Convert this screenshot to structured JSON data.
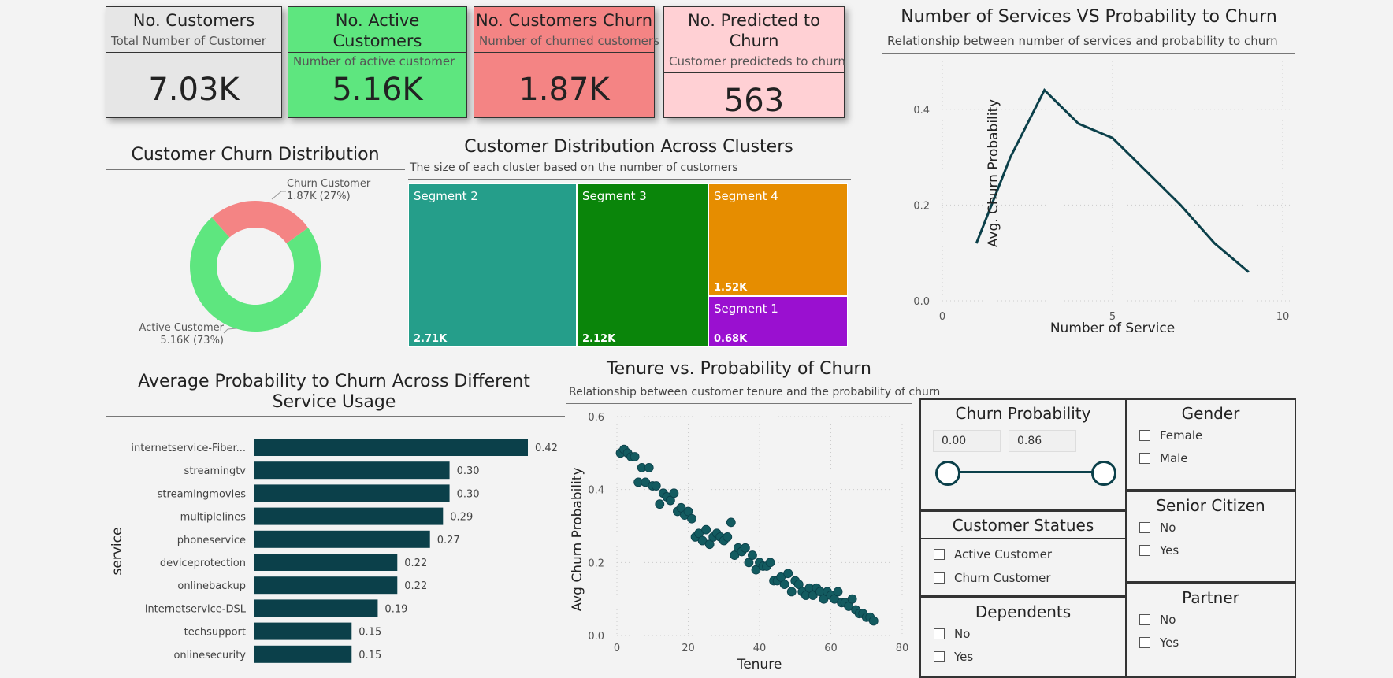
{
  "kpis": {
    "total": {
      "title": "No. Customers",
      "subtitle": "Total Number of Customer",
      "value": "7.03K"
    },
    "active": {
      "title": "No. Active Customers",
      "subtitle": "Number of active customer",
      "value": "5.16K"
    },
    "churn": {
      "title": "No. Customers Churn",
      "subtitle": "Number of churned customers",
      "value": "1.87K"
    },
    "predicted": {
      "title": "No. Predicted to Churn",
      "subtitle": "Customer predicteds to churn",
      "value": "563"
    }
  },
  "colors": {
    "active": "#5ee67f",
    "churn": "#f48484",
    "predicted": "#ffd0d4",
    "total": "#e6e6e6",
    "teal": "#0b404a"
  },
  "chart_data": [
    {
      "type": "pie",
      "title": "Customer Churn Distribution",
      "categories": [
        "Churn Customer",
        "Active Customer"
      ],
      "values": [
        1.87,
        5.16
      ],
      "labels": [
        "Churn Customer",
        "Active Customer"
      ],
      "value_labels": [
        "1.87K (27%)",
        "5.16K (73%)"
      ],
      "colors": [
        "#f48484",
        "#5ee67f"
      ]
    },
    {
      "type": "treemap",
      "title": "Customer Distribution Across Clusters",
      "subtitle": "The size of each cluster based on the number of customers",
      "categories": [
        "Segment 2",
        "Segment 3",
        "Segment 4",
        "Segment 1"
      ],
      "values": [
        2.71,
        2.12,
        1.52,
        0.68
      ],
      "value_labels": [
        "2.71K",
        "2.12K",
        "1.52K",
        "0.68K"
      ],
      "colors": [
        "#259e8a",
        "#0a850a",
        "#e68d00",
        "#9a10d0"
      ]
    },
    {
      "type": "line",
      "title": "Number of Services VS Probability to Churn",
      "subtitle": "Relationship between number of services and probability to churn",
      "xlabel": "Number of Service",
      "ylabel": "Avg. Churn Probability",
      "x": [
        1,
        2,
        3,
        4,
        5,
        6,
        7,
        8,
        9
      ],
      "y": [
        0.12,
        0.3,
        0.44,
        0.37,
        0.34,
        0.27,
        0.2,
        0.12,
        0.06
      ],
      "xlim": [
        0,
        10
      ],
      "ylim": [
        0,
        0.5
      ],
      "xticks": [
        "0",
        "5",
        "10"
      ],
      "yticks": [
        "0.0",
        "0.2",
        "0.4"
      ]
    },
    {
      "type": "bar",
      "title": "Average Probability to Churn Across Different Service Usage",
      "ylabel": "service",
      "categories": [
        "internetservice-Fiber...",
        "streamingtv",
        "streamingmovies",
        "multiplelines",
        "phoneservice",
        "deviceprotection",
        "onlinebackup",
        "internetservice-DSL",
        "techsupport",
        "onlinesecurity"
      ],
      "values": [
        0.42,
        0.3,
        0.3,
        0.29,
        0.27,
        0.22,
        0.22,
        0.19,
        0.15,
        0.15
      ],
      "value_labels": [
        "0.42",
        "0.30",
        "0.30",
        "0.29",
        "0.27",
        "0.22",
        "0.22",
        "0.19",
        "0.15",
        "0.15"
      ]
    },
    {
      "type": "scatter",
      "title": "Tenure vs. Probability of Churn",
      "subtitle": "Relationship between customer tenure and the probability of churn",
      "xlabel": "Tenure",
      "ylabel": "Avg Churn Probability",
      "xlim": [
        0,
        80
      ],
      "ylim": [
        0,
        0.6
      ],
      "xticks": [
        "0",
        "20",
        "40",
        "60",
        "80"
      ],
      "yticks": [
        "0.0",
        "0.2",
        "0.4",
        "0.6"
      ],
      "x": [
        1,
        2,
        3,
        4,
        5,
        6,
        7,
        8,
        9,
        10,
        11,
        12,
        13,
        14,
        15,
        16,
        17,
        18,
        19,
        20,
        21,
        22,
        23,
        24,
        25,
        26,
        27,
        28,
        29,
        30,
        31,
        32,
        33,
        34,
        35,
        36,
        37,
        38,
        39,
        40,
        41,
        42,
        43,
        44,
        45,
        46,
        47,
        48,
        49,
        50,
        51,
        52,
        53,
        54,
        55,
        56,
        57,
        58,
        59,
        60,
        61,
        62,
        63,
        64,
        65,
        66,
        67,
        68,
        69,
        70,
        71,
        72
      ],
      "y": [
        0.5,
        0.51,
        0.5,
        0.49,
        0.49,
        0.42,
        0.46,
        0.42,
        0.46,
        0.41,
        0.41,
        0.36,
        0.39,
        0.38,
        0.37,
        0.39,
        0.34,
        0.35,
        0.33,
        0.34,
        0.32,
        0.27,
        0.28,
        0.26,
        0.29,
        0.25,
        0.27,
        0.28,
        0.27,
        0.26,
        0.27,
        0.31,
        0.22,
        0.24,
        0.23,
        0.24,
        0.2,
        0.22,
        0.18,
        0.2,
        0.19,
        0.19,
        0.2,
        0.15,
        0.15,
        0.16,
        0.14,
        0.17,
        0.12,
        0.15,
        0.14,
        0.12,
        0.11,
        0.13,
        0.11,
        0.13,
        0.12,
        0.1,
        0.12,
        0.11,
        0.1,
        0.12,
        0.09,
        0.09,
        0.08,
        0.1,
        0.07,
        0.06,
        0.06,
        0.05,
        0.05,
        0.04
      ]
    }
  ],
  "filters": {
    "churn_probability": {
      "title": "Churn Probability",
      "min_value": "0.00",
      "max_value": "0.86"
    },
    "gender": {
      "title": "Gender",
      "options": [
        "Female",
        "Male"
      ]
    },
    "customer_status": {
      "title": "Customer Statues",
      "options": [
        "Active Customer",
        "Churn Customer"
      ]
    },
    "senior_citizen": {
      "title": "Senior Citizen",
      "options": [
        "No",
        "Yes"
      ]
    },
    "dependents": {
      "title": "Dependents",
      "options": [
        "No",
        "Yes"
      ]
    },
    "partner": {
      "title": "Partner",
      "options": [
        "No",
        "Yes"
      ]
    }
  }
}
